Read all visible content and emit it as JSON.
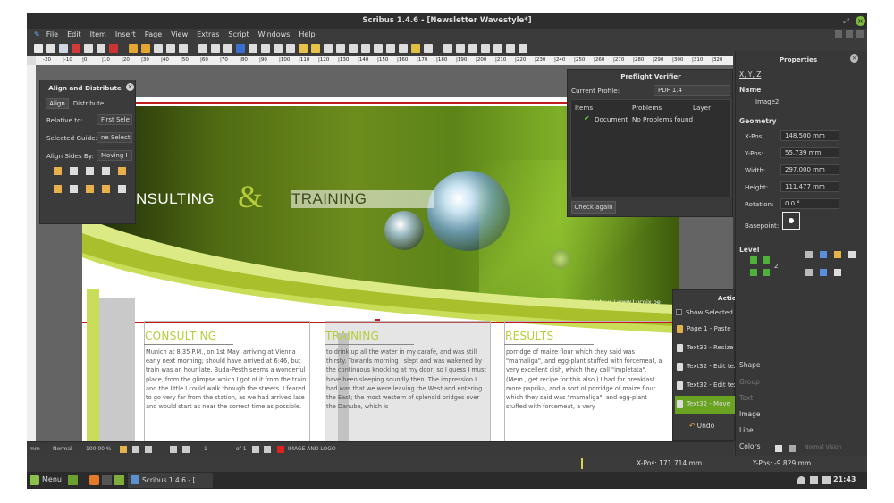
{
  "window": {
    "title": "Scribus 1.4.6 - [Newsletter Wavestyle*]"
  },
  "menu": [
    "File",
    "Edit",
    "Item",
    "Insert",
    "Page",
    "View",
    "Extras",
    "Script",
    "Windows",
    "Help"
  ],
  "ruler": {
    "ticks": [
      "-20",
      "|-10",
      "|0",
      "|10",
      "|20",
      "|30",
      "|40",
      "|50",
      "|60",
      "|70",
      "|80",
      "|90",
      "|100",
      "|110",
      "|120",
      "|130",
      "|140",
      "|150",
      "|160",
      "|170",
      "|180",
      "|190",
      "|200",
      "|210",
      "|220",
      "|230",
      "|240",
      "|250",
      "|260",
      "|270",
      "|280",
      "|290",
      "|300",
      "|310",
      "|320"
    ]
  },
  "document": {
    "logo_left": "NSULTING",
    "logo_amp": "&",
    "logo_right": "TRAINING",
    "photo_credit": "Dew on grass by Luc Viatour / www.Lucnix.be",
    "columns": [
      {
        "heading": "CONSULTING",
        "text": "Munich at 8:35 P.M., on 1st May, arriving at Vienna early next morning; should have arrived at 6:46, but train was an hour late. Buda-Pesth seems a wonderful place, from the glimpse which I got of it from the train and the little I could walk through the streets. I feared to go very far from the station, as we had arrived late and would start as near the correct time as possible."
      },
      {
        "heading": "TRAINING",
        "text": "to drink up all the water in my carafe, and was still thirsty. Towards morning I slept and was wakened by the continuous knocking at my door, so I guess I must have been sleeping soundly then. The impression I had was that we were leaving the West and entering the East; the most western of splendid bridges over the Danube, which is"
      },
      {
        "heading": "RESULTS",
        "text": "porridge of maize flour which they said was \"mamaliga\", and egg-plant stuffed with forcemeat, a very excellent dish, which they call \"impletata\". (Mem., get recipe for this also.) I had for breakfast more paprika, and a sort of porridge of maize flour which they said was \"mamaliga\", and egg-plant stuffed with forcemeat, a very"
      }
    ]
  },
  "align": {
    "title": "Align and Distribute",
    "tabs": [
      "Align",
      "Distribute"
    ],
    "relative_label": "Relative to:",
    "relative_value": "First Sele",
    "guide_label": "Selected Guide:",
    "guide_value": "ne Selected",
    "sides_label": "Align Sides By:",
    "sides_value": "Moving I"
  },
  "preflight": {
    "title": "Preflight Verifier",
    "profile_label": "Current Profile:",
    "profile_value": "PDF 1.4",
    "col_items": "Items",
    "col_problems": "Problems",
    "col_layer": "Layer",
    "row_item": "Document",
    "row_problem": "No Problems found",
    "check_button": "Check again"
  },
  "actions": {
    "title": "Actio",
    "show_selected": "Show Selected O",
    "items": [
      "Page 1 - Paste",
      "Text32 - Resize",
      "Text32 - Edit tex",
      "Text32 - Edit tex",
      "Text32 - Move"
    ],
    "undo": "Undo"
  },
  "properties": {
    "title": "Properties",
    "tab": "X, Y, Z",
    "name_label": "Name",
    "name_value": "Image2",
    "geometry_label": "Geometry",
    "xpos_label": "X-Pos:",
    "xpos_value": "148.500 mm",
    "ypos_label": "Y-Pos:",
    "ypos_value": "55.739 mm",
    "width_label": "Width:",
    "width_value": "297.000 mm",
    "height_label": "Height:",
    "height_value": "111.477 mm",
    "rotation_label": "Rotation:",
    "rotation_value": "0.0 °",
    "basepoint_label": "Basepoint:",
    "level_label": "Level",
    "level_value": "2",
    "sections": [
      "Shape",
      "Group",
      "Text",
      "Image",
      "Line",
      "Colors"
    ]
  },
  "status": {
    "unit": "mm",
    "mode": "Normal",
    "zoom": "100.00 %",
    "page": "1",
    "of": "of 1",
    "layer": "IMAGE AND LOGO",
    "right_mode": "Normal Vision"
  },
  "coords": {
    "x": "X-Pos:  171.714 mm",
    "y": "Y-Pos:  -9.829 mm"
  },
  "taskbar": {
    "menu": "Menu",
    "app": "Scribus 1.4.6 - [...",
    "time": "21:43"
  },
  "colors": {
    "accent": "#b7cc3a",
    "green_button": "#6aa322"
  }
}
